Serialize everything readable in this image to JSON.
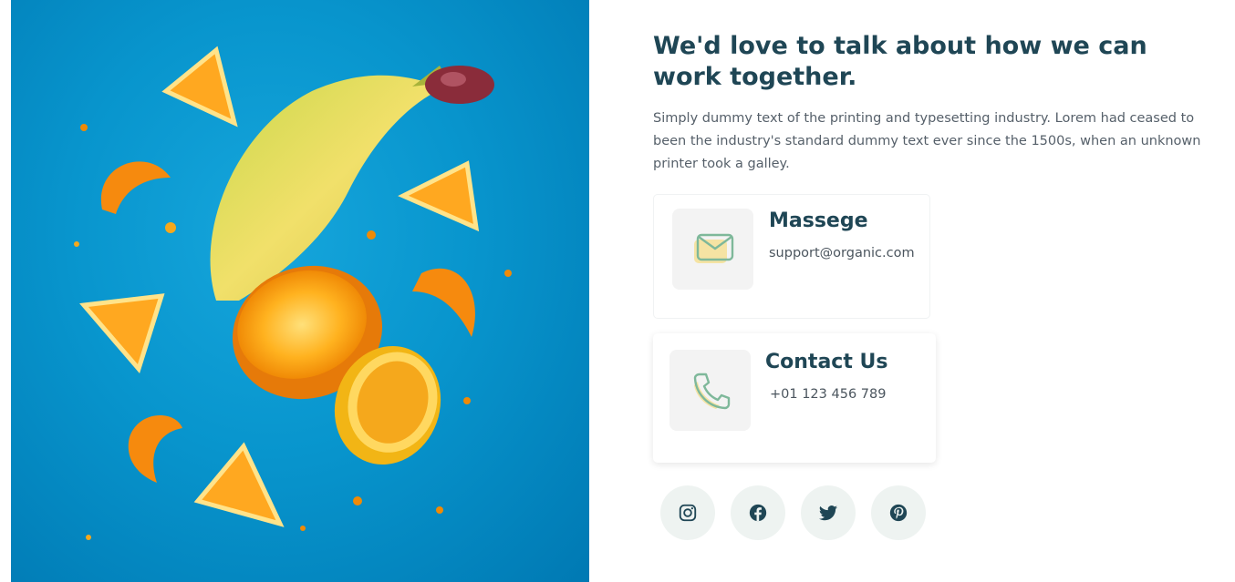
{
  "hero": {
    "image": "flying-fruit-photo",
    "background_color": "#0895cd"
  },
  "section": {
    "headline": "We'd love to talk about how we can work together.",
    "intro": "Simply dummy text of the printing and typesetting industry. Lorem had ceased to been the industry's standard dummy text ever since the 1500s, when an unknown printer took a galley."
  },
  "cards": {
    "message": {
      "title": "Massege",
      "text": "support@organic.com",
      "icon": "mail-icon"
    },
    "contact": {
      "title": "Contact Us",
      "text": "+01 123 456 789",
      "icon": "phone-icon"
    }
  },
  "socials": [
    {
      "icon": "instagram-icon"
    },
    {
      "icon": "facebook-icon"
    },
    {
      "icon": "twitter-icon"
    },
    {
      "icon": "pinterest-icon"
    }
  ],
  "colors": {
    "heading": "#1f4655",
    "accent_green": "#7eb89a",
    "accent_yellow": "#f5e3a3",
    "social_bg": "#eef3f1"
  }
}
